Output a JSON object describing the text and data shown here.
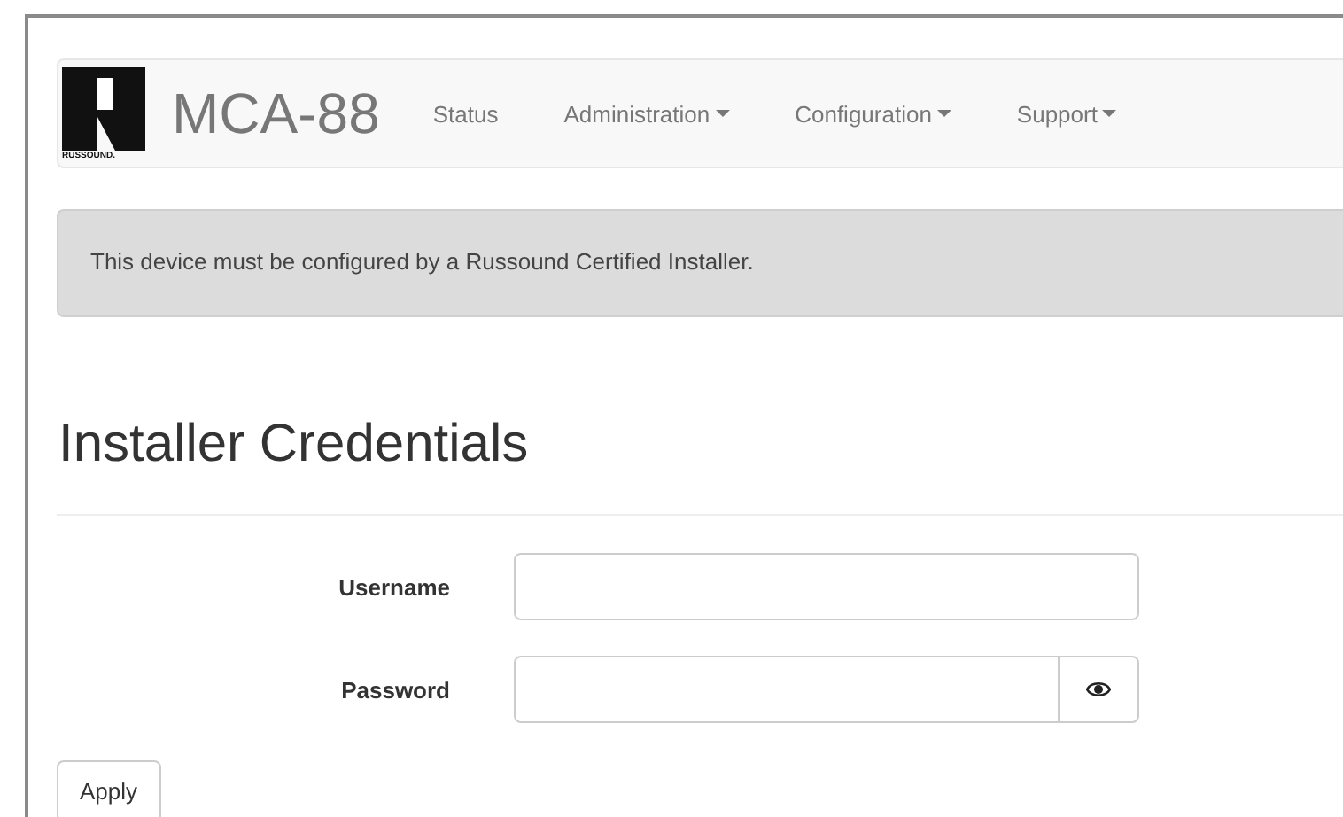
{
  "navbar": {
    "logo_caption": "RUSSOUND.",
    "brand": "MCA-88",
    "items": [
      {
        "label": "Status",
        "dropdown": false
      },
      {
        "label": "Administration",
        "dropdown": true
      },
      {
        "label": "Configuration",
        "dropdown": true
      },
      {
        "label": "Support",
        "dropdown": true
      }
    ]
  },
  "alert": {
    "text": "This device must be configured by a Russound Certified Installer."
  },
  "heading": "Installer Credentials",
  "fields": [
    {
      "label": "Username",
      "kind": "text"
    },
    {
      "label": "Password",
      "kind": "password"
    }
  ],
  "buttons": [
    "Apply"
  ]
}
